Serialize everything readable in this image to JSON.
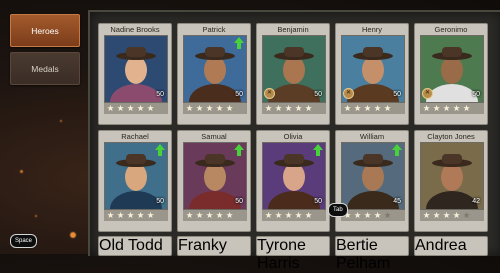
{
  "tabs": {
    "heroes": "Heroes",
    "medals": "Medals"
  },
  "heroes": [
    {
      "name": "Nadine Brooks",
      "level": "50",
      "stars": 5,
      "upgrade": false,
      "badge": false
    },
    {
      "name": "Patrick",
      "level": "50",
      "stars": 5,
      "upgrade": true,
      "badge": false
    },
    {
      "name": "Benjamin",
      "level": "50",
      "stars": 5,
      "upgrade": false,
      "badge": true
    },
    {
      "name": "Henry",
      "level": "50",
      "stars": 5,
      "upgrade": false,
      "badge": true
    },
    {
      "name": "Geronimo",
      "level": "50",
      "stars": 5,
      "upgrade": false,
      "badge": true
    },
    {
      "name": "Rachael",
      "level": "50",
      "stars": 5,
      "upgrade": true,
      "badge": false
    },
    {
      "name": "Samual",
      "level": "50",
      "stars": 5,
      "upgrade": true,
      "badge": false
    },
    {
      "name": "Olivia",
      "level": "50",
      "stars": 5,
      "upgrade": true,
      "badge": false
    },
    {
      "name": "William",
      "level": "45",
      "stars": 4,
      "upgrade": true,
      "badge": false
    },
    {
      "name": "Clayton Jones",
      "level": "42",
      "stars": 4,
      "upgrade": false,
      "badge": false
    }
  ],
  "bottom_row": [
    "Old Todd",
    "Franky",
    "Tyrone Harris",
    "Bertie Pelham",
    "Andrea"
  ],
  "key_hints": {
    "tab": "Tab",
    "space": "Space"
  }
}
